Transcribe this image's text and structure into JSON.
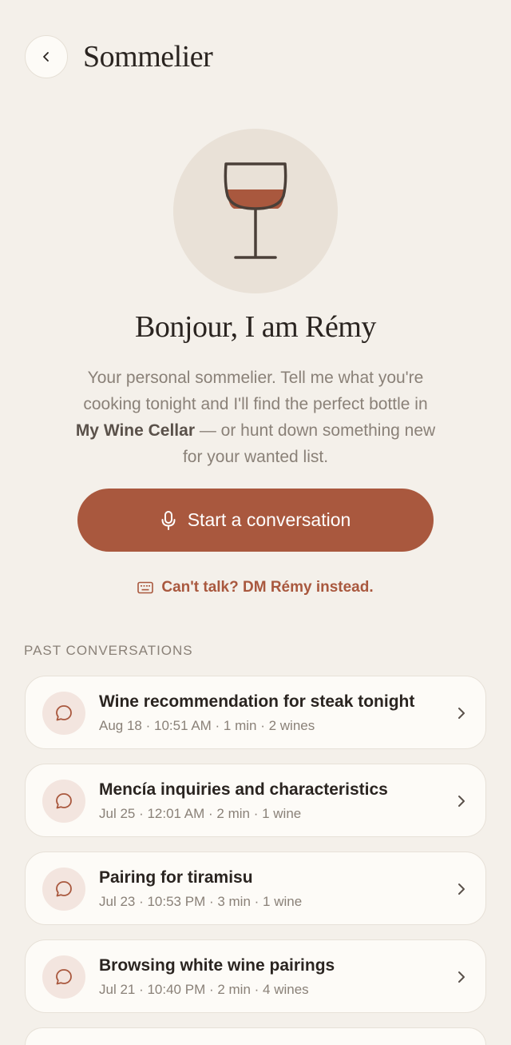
{
  "header": {
    "title": "Sommelier"
  },
  "hero": {
    "greeting": "Bonjour, I am Rémy",
    "intro_before": "Your personal sommelier. Tell me what you're cooking tonight and I'll find the perfect bottle in ",
    "intro_bold": "My Wine Cellar",
    "intro_after": " — or hunt down something new for your wanted list."
  },
  "cta": {
    "label": "Start a conversation"
  },
  "dm": {
    "label": "Can't talk? DM Rémy instead."
  },
  "past": {
    "heading": "PAST CONVERSATIONS",
    "items": [
      {
        "title": "Wine recommendation for steak tonight",
        "meta": "Aug 18 · 10:51 AM · 1 min · 2 wines"
      },
      {
        "title": "Mencía inquiries and characteristics",
        "meta": "Jul 25 · 12:01 AM · 2 min · 1 wine"
      },
      {
        "title": "Pairing for tiramisu",
        "meta": "Jul 23 · 10:53 PM · 3 min · 1 wine"
      },
      {
        "title": "Browsing white wine pairings",
        "meta": "Jul 21 · 10:40 PM · 2 min · 4 wines"
      }
    ]
  },
  "colors": {
    "accent": "#a9583e",
    "background": "#f4f0ea",
    "card": "#fdfbf7"
  },
  "icons": [
    "chevron-left-icon",
    "wine-glass-icon",
    "microphone-icon",
    "keyboard-icon",
    "chat-bubble-icon",
    "chevron-right-icon"
  ]
}
